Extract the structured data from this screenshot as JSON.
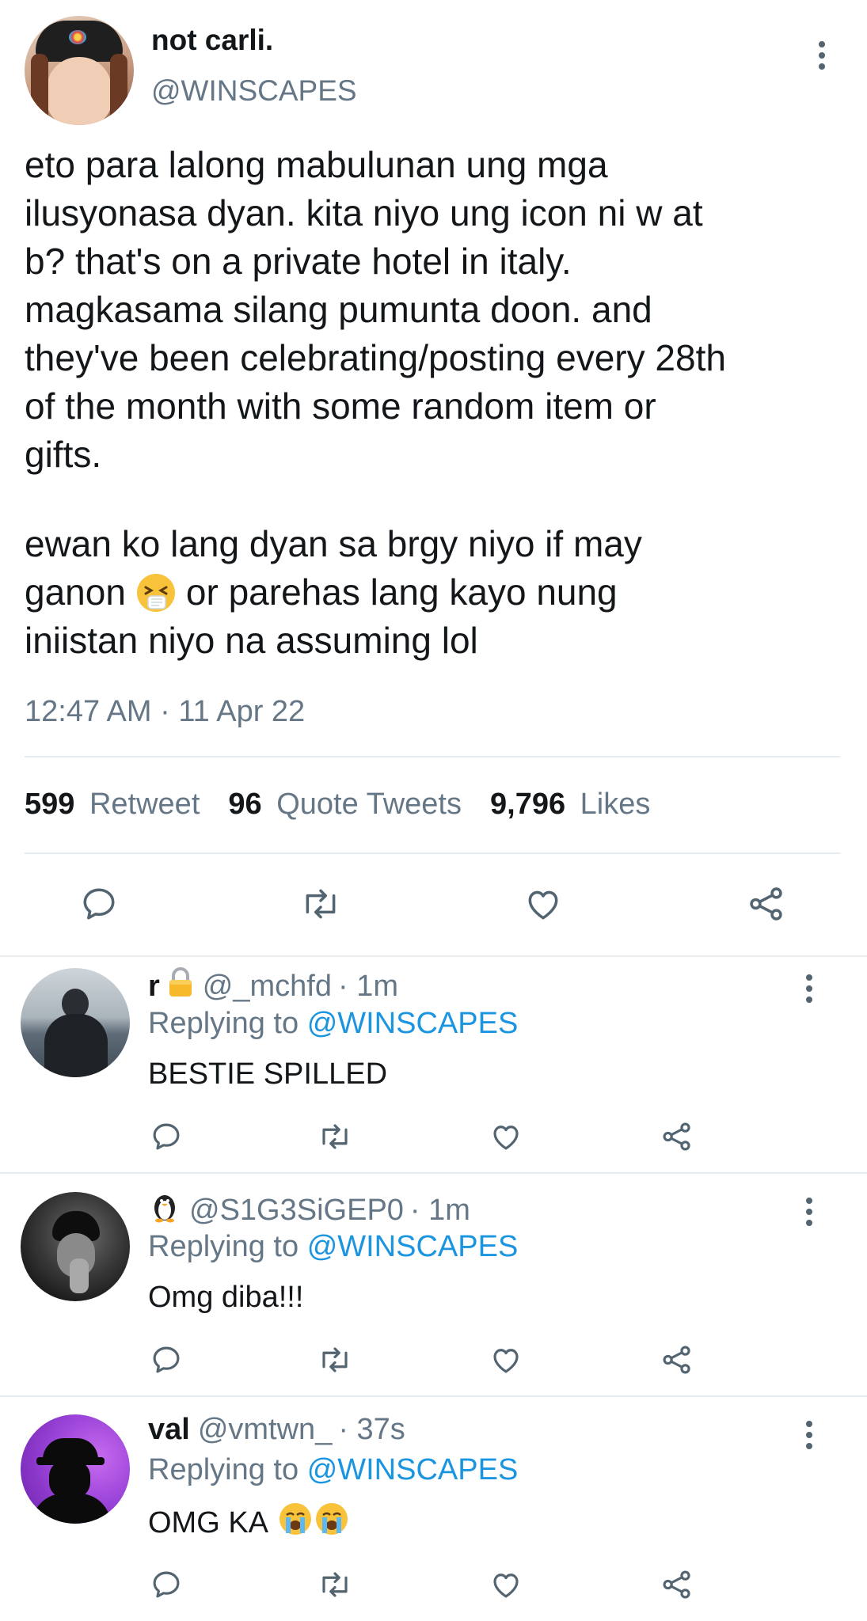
{
  "tweet": {
    "display_name": "not carli.",
    "handle": "@WINSCAPES",
    "lines": [
      "eto para lalong mabulunan ung mga",
      "ilusyonasa dyan. kita niyo ung icon ni w at",
      "b? that's on a private hotel in italy.",
      "magkasama silang pumunta doon. and",
      "they've been celebrating/posting every 28th",
      "of the month with some random item or",
      "gifts."
    ],
    "para2_line1": "ewan ko lang dyan sa brgy niyo if may",
    "para2_line2_before": "ganon",
    "para2_line2_after": "or parehas lang kayo nung",
    "para2_line3": "iniistan niyo na assuming lol",
    "timestamp": "12:47 AM · 11 Apr 22",
    "stats": {
      "retweets_count": "599",
      "retweets_label": "Retweet",
      "quotes_count": "96",
      "quotes_label": "Quote Tweets",
      "likes_count": "9,796",
      "likes_label": "Likes"
    }
  },
  "replies": [
    {
      "name": "r",
      "handle": "@_mchfd",
      "time": "· 1m",
      "replying_label": "Replying to",
      "replying_to": "@WINSCAPES",
      "text": "BESTIE SPILLED"
    },
    {
      "name": "",
      "handle": "@S1G3SiGEP0",
      "time": "· 1m",
      "replying_label": "Replying to",
      "replying_to": "@WINSCAPES",
      "text": "Omg diba!!!"
    },
    {
      "name": "val",
      "handle": "@vmtwn_",
      "time": "· 37s",
      "replying_label": "Replying to",
      "replying_to": "@WINSCAPES",
      "text": "OMG KA"
    }
  ],
  "colors": {
    "accent_blue": "#1b95e0",
    "muted_gray": "#657786",
    "divider": "#e6ecf0"
  }
}
